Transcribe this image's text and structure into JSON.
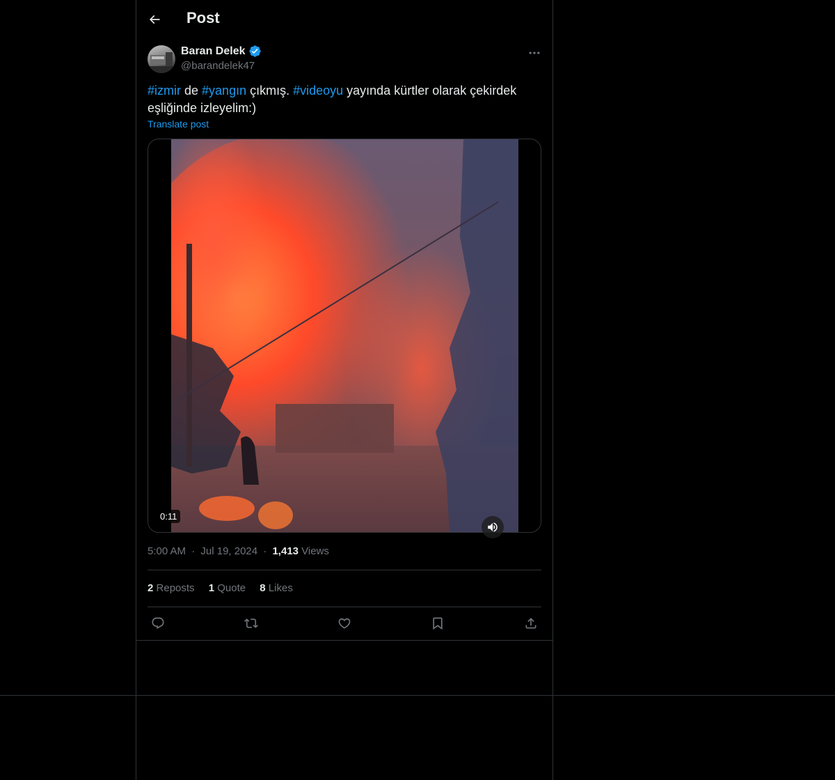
{
  "header": {
    "title": "Post"
  },
  "author": {
    "name": "Baran Delek",
    "handle": "@barandelek47",
    "verified": true
  },
  "post": {
    "segments": [
      {
        "text": "#izmir",
        "hashtag": true
      },
      {
        "text": " de ",
        "hashtag": false
      },
      {
        "text": "#yangın",
        "hashtag": true
      },
      {
        "text": " çıkmış. ",
        "hashtag": false
      },
      {
        "text": "#videoyu",
        "hashtag": true
      },
      {
        "text": " yayında kürtler olarak çekirdek eşliğinde izleyelim:)",
        "hashtag": false
      }
    ],
    "translate_label": "Translate post",
    "video_duration": "0:11"
  },
  "meta": {
    "time": "5:00 AM",
    "date": "Jul 19, 2024",
    "separator": "·",
    "views_count": "1,413",
    "views_label": "Views"
  },
  "stats": {
    "reposts_count": "2",
    "reposts_label": "Reposts",
    "quotes_count": "1",
    "quotes_label": "Quote",
    "likes_count": "8",
    "likes_label": "Likes"
  },
  "colors": {
    "accent": "#1d9bf0",
    "background": "#000000",
    "border": "#2f3336",
    "secondary_text": "#71767b"
  },
  "icons": [
    "back-arrow-icon",
    "verified-badge-icon",
    "more-icon",
    "speaker-icon",
    "reply-icon",
    "repost-icon",
    "like-icon",
    "bookmark-icon",
    "share-icon"
  ]
}
